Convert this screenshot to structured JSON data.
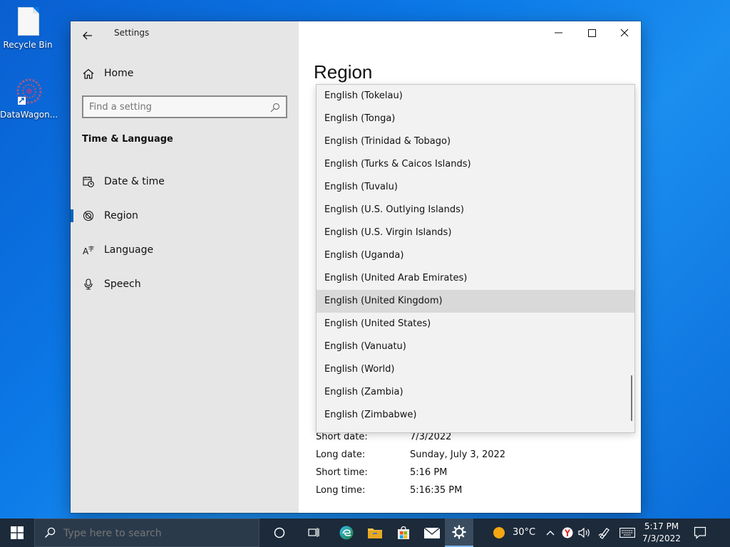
{
  "desktop": {
    "icons": [
      {
        "label": "Recycle Bin"
      },
      {
        "label": "DataWagon..."
      }
    ]
  },
  "window": {
    "title": "Settings",
    "home_label": "Home",
    "search_placeholder": "Find a setting",
    "section_title": "Time & Language",
    "nav": [
      {
        "label": "Date & time",
        "icon": "calendar-clock-icon"
      },
      {
        "label": "Region",
        "icon": "globe-icon",
        "active": true
      },
      {
        "label": "Language",
        "icon": "language-icon"
      },
      {
        "label": "Speech",
        "icon": "microphone-icon"
      }
    ],
    "page_heading": "Region"
  },
  "dropdown": {
    "items": [
      "English (Tokelau)",
      "English (Tonga)",
      "English (Trinidad & Tobago)",
      "English (Turks & Caicos Islands)",
      "English (Tuvalu)",
      "English (U.S. Outlying Islands)",
      "English (U.S. Virgin Islands)",
      "English (Uganda)",
      "English (United Arab Emirates)",
      "English (United Kingdom)",
      "English (United States)",
      "English (Vanuatu)",
      "English (World)",
      "English (Zambia)",
      "English (Zimbabwe)"
    ],
    "selected": "English (United Kingdom)"
  },
  "formats": [
    {
      "label": "Short date:",
      "value": "7/3/2022"
    },
    {
      "label": "Long date:",
      "value": "Sunday, July 3, 2022"
    },
    {
      "label": "Short time:",
      "value": "5:16 PM"
    },
    {
      "label": "Long time:",
      "value": "5:16:35 PM"
    }
  ],
  "taskbar": {
    "search_placeholder": "Type here to search",
    "weather": "30°C",
    "time": "5:17 PM",
    "date": "7/3/2022"
  },
  "colors": {
    "accent": "#0067c0",
    "sidebar_bg": "#e6e6e6",
    "taskbar_bg": "#1c2a3a",
    "selected_item_bg": "#d9d9d9"
  }
}
